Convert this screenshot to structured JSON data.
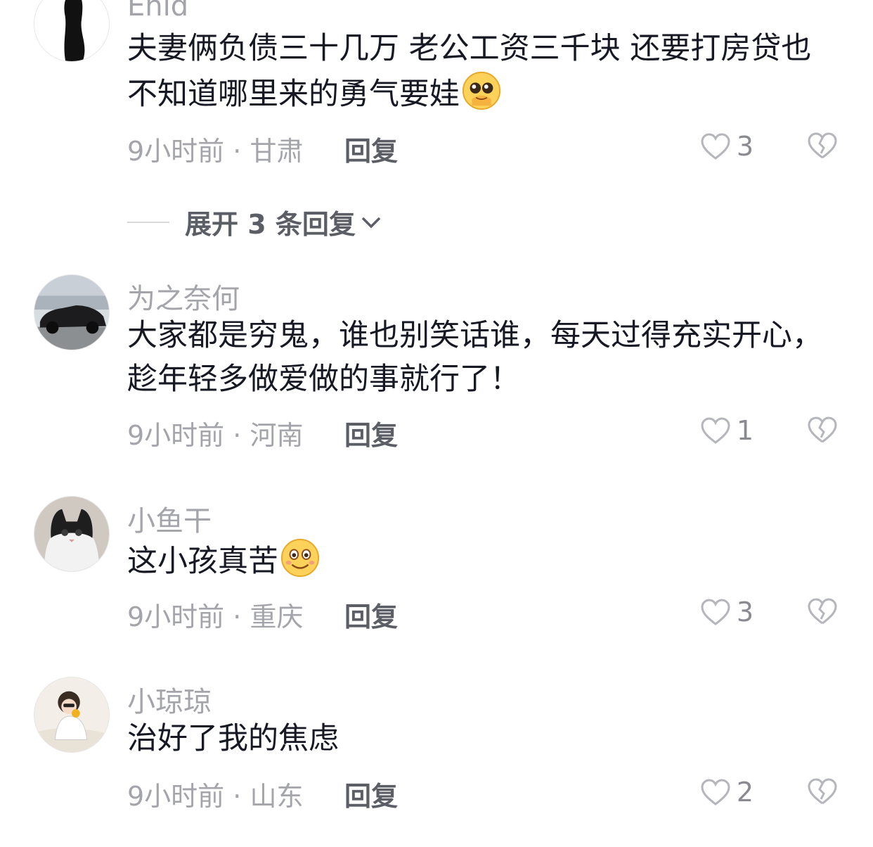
{
  "comments": [
    {
      "username": "Enid",
      "text": "夫妻俩负债三十几万 老公工资三千块 还要打房贷也不知道哪里来的勇气要娃",
      "emoji": "pleading-face-emoji",
      "time": "9小时前",
      "location": "甘肃",
      "reply_label": "回复",
      "likes": "3"
    },
    {
      "username": "为之奈何",
      "text": "大家都是穷鬼，谁也别笑话谁，每天过得充实开心，趁年轻多做爱做的事就行了！",
      "time": "9小时前",
      "location": "河南",
      "reply_label": "回复",
      "likes": "1"
    },
    {
      "username": "小鱼干",
      "text": "这小孩真苦",
      "emoji": "smiling-face-emoji",
      "time": "9小时前",
      "location": "重庆",
      "reply_label": "回复",
      "likes": "3"
    },
    {
      "username": "小琼琼",
      "text": "治好了我的焦虑",
      "time": "9小时前",
      "location": "山东",
      "reply_label": "回复",
      "likes": "2"
    }
  ],
  "expand_replies": {
    "label": "展开 3 条回复"
  },
  "icons": {
    "like": "heart-outline-icon",
    "dislike": "broken-heart-icon",
    "expand": "chevron-down-icon"
  },
  "colors": {
    "text": "#161823",
    "secondary": "#a4a5aa",
    "reply": "#5c5e66"
  }
}
